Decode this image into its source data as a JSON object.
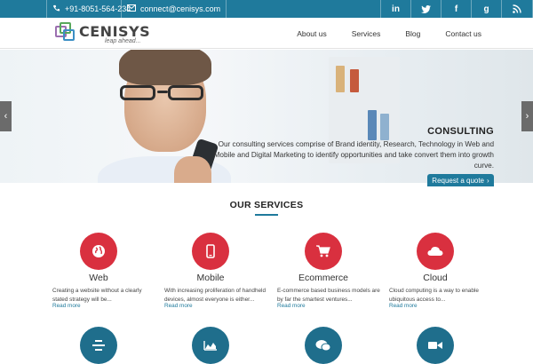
{
  "topbar": {
    "phone": "+91-8051-564-234",
    "email": "connect@cenisys.com",
    "socials": [
      {
        "icon": "linkedin-icon",
        "glyph": "in"
      },
      {
        "icon": "twitter-icon",
        "glyph": "t"
      },
      {
        "icon": "facebook-icon",
        "glyph": "f"
      },
      {
        "icon": "google-plus-icon",
        "glyph": "g"
      },
      {
        "icon": "rss-icon",
        "glyph": "◌"
      }
    ]
  },
  "brand": {
    "name": "CENISYS",
    "tagline": "leap ahead..."
  },
  "nav": {
    "items": [
      "About us",
      "Services",
      "Blog",
      "Contact us"
    ]
  },
  "hero": {
    "title": "CONSULTING",
    "text": "Our consulting services comprise of Brand identity, Research, Technology in Web and Mobile and Digital Marketing to identify opportunities and take convert them into growth curve.",
    "cta": "Request a quote"
  },
  "services": {
    "title": "OUR SERVICES",
    "items": [
      {
        "name": "Web",
        "icon": "globe-icon",
        "desc": "Creating a website without a clearly stated strategy will be...",
        "more": "Read more"
      },
      {
        "name": "Mobile",
        "icon": "mobile-icon",
        "desc": "With increasing proliferation of handheld devices, almost everyone is either...",
        "more": "Read more"
      },
      {
        "name": "Ecommerce",
        "icon": "cart-icon",
        "desc": "E-commerce based business models are by far the smartest ventures...",
        "more": "Read more"
      },
      {
        "name": "Cloud",
        "icon": "cloud-icon",
        "desc": "Cloud computing is a way to enable ubiquitous access to...",
        "more": "Read more"
      }
    ],
    "second_row_icons": [
      "stack-icon",
      "chart-icon",
      "chat-icon",
      "video-icon"
    ]
  },
  "colors": {
    "primary": "#1f7a9c",
    "service_red": "#d9303f",
    "service_blue": "#1f6e8c"
  }
}
